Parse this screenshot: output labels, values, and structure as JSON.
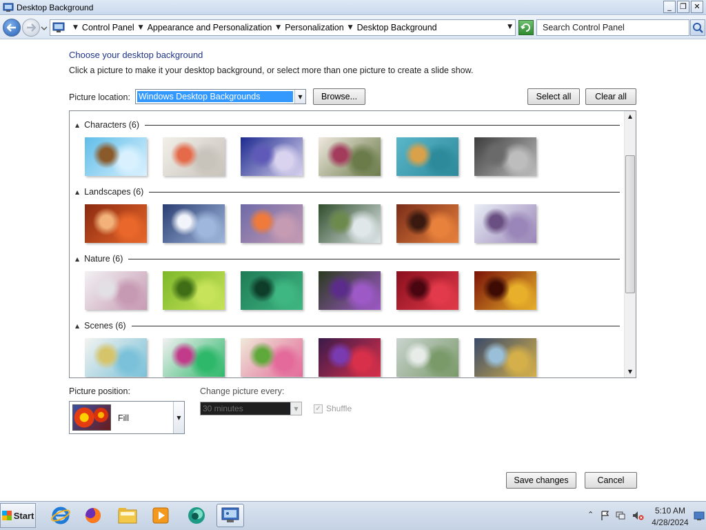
{
  "window": {
    "title": "Desktop Background",
    "controls": {
      "minimize": "_",
      "maximize": "❐",
      "close": "✕"
    }
  },
  "address": {
    "crumbs": [
      "Control Panel",
      "Appearance and Personalization",
      "Personalization",
      "Desktop Background"
    ],
    "search_placeholder": "Search Control Panel"
  },
  "page": {
    "heading": "Choose your desktop background",
    "subheading": "Click a picture to make it your desktop background, or select more than one picture to create a slide show.",
    "location_label": "Picture location:",
    "location_value": "Windows Desktop Backgrounds",
    "browse_label": "Browse...",
    "select_all_label": "Select all",
    "clear_all_label": "Clear all"
  },
  "groups": [
    {
      "title": "Characters (6)",
      "thumbs": [
        {
          "name": "characters-1",
          "colors": [
            "#5fbde8",
            "#d9f1ff",
            "#8a5a2b"
          ]
        },
        {
          "name": "characters-2",
          "colors": [
            "#f2efe9",
            "#c8c3bb",
            "#e46a4a"
          ]
        },
        {
          "name": "characters-3",
          "colors": [
            "#1d2a8f",
            "#d9d3ef",
            "#5f5ab8"
          ]
        },
        {
          "name": "characters-4",
          "colors": [
            "#efe8de",
            "#6b7b4a",
            "#a33b5c"
          ]
        },
        {
          "name": "characters-5",
          "colors": [
            "#5ab6c9",
            "#2d8a9b",
            "#d9a14a"
          ]
        },
        {
          "name": "characters-6",
          "colors": [
            "#3d3d3d",
            "#bdbdbd",
            "#6a6a6a"
          ]
        }
      ]
    },
    {
      "title": "Landscapes (6)",
      "thumbs": [
        {
          "name": "landscapes-1",
          "colors": [
            "#8a2a10",
            "#e9672a",
            "#f2b27a"
          ]
        },
        {
          "name": "landscapes-2",
          "colors": [
            "#2b3e73",
            "#9fb7dc",
            "#f1f4fa"
          ]
        },
        {
          "name": "landscapes-3",
          "colors": [
            "#6e6aa8",
            "#c59bb3",
            "#f07a3a"
          ]
        },
        {
          "name": "landscapes-4",
          "colors": [
            "#2f4d2b",
            "#dfe7e9",
            "#6d8a4d"
          ]
        },
        {
          "name": "landscapes-5",
          "colors": [
            "#7a2d1a",
            "#e8813b",
            "#3a1a10"
          ]
        },
        {
          "name": "landscapes-6",
          "colors": [
            "#e9eef6",
            "#9a86b8",
            "#6a4f82"
          ]
        }
      ]
    },
    {
      "title": "Nature (6)",
      "thumbs": [
        {
          "name": "nature-1",
          "colors": [
            "#f2f1f3",
            "#c79ab3",
            "#e3e0e5"
          ]
        },
        {
          "name": "nature-2",
          "colors": [
            "#7db82a",
            "#c7e35a",
            "#3f6e16"
          ]
        },
        {
          "name": "nature-3",
          "colors": [
            "#1f7b56",
            "#3fb782",
            "#0e3d2a"
          ]
        },
        {
          "name": "nature-4",
          "colors": [
            "#2a3a1f",
            "#9d59c6",
            "#5b2c8a"
          ]
        },
        {
          "name": "nature-5",
          "colors": [
            "#8a0f1e",
            "#e23a4a",
            "#4a0610"
          ]
        },
        {
          "name": "nature-6",
          "colors": [
            "#7a1208",
            "#e8b02a",
            "#3d0a04"
          ]
        }
      ]
    },
    {
      "title": "Scenes (6)",
      "thumbs": [
        {
          "name": "scenes-1",
          "colors": [
            "#f3f3f0",
            "#7ac1d9",
            "#d6c46a"
          ]
        },
        {
          "name": "scenes-2",
          "colors": [
            "#f2f0f2",
            "#2eb86a",
            "#c23a8a"
          ]
        },
        {
          "name": "scenes-3",
          "colors": [
            "#efe9d8",
            "#e36a9a",
            "#5fa83a"
          ]
        },
        {
          "name": "scenes-4",
          "colors": [
            "#3a1a4a",
            "#d8304a",
            "#7a3ab0"
          ]
        },
        {
          "name": "scenes-5",
          "colors": [
            "#c9d3cf",
            "#7a9a6a",
            "#e7ece9"
          ]
        },
        {
          "name": "scenes-6",
          "colors": [
            "#3a4a6a",
            "#d5b04a",
            "#9ac0d9"
          ]
        }
      ]
    }
  ],
  "options": {
    "position_label": "Picture position:",
    "position_value": "Fill",
    "change_label": "Change picture every:",
    "interval_value": "30 minutes",
    "shuffle_label": "Shuffle",
    "shuffle_checked": true
  },
  "footer": {
    "save_label": "Save changes",
    "cancel_label": "Cancel"
  },
  "taskbar": {
    "start_label": "Start",
    "pinned": [
      "internet-explorer-icon",
      "firefox-icon",
      "file-explorer-icon",
      "media-player-icon",
      "browser-globe-icon",
      "control-panel-icon"
    ],
    "time": "5:10 AM",
    "date": "4/28/2024"
  }
}
